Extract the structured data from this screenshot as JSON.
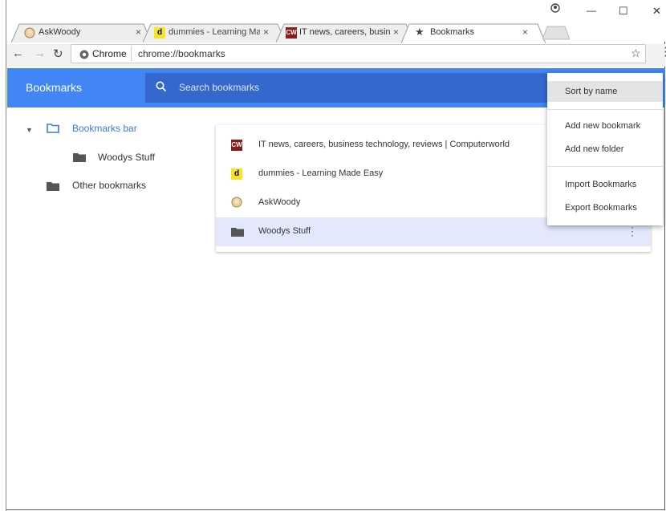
{
  "tabs": [
    {
      "title": "AskWoody",
      "close": "×"
    },
    {
      "title": "dummies - Learning Made Easy",
      "close": "×",
      "favicon_text": "d"
    },
    {
      "title": "IT news, careers, business technology, reviews | Computerworld",
      "close": "×",
      "favicon_text": "CW"
    },
    {
      "title": "Bookmarks",
      "close": "×"
    }
  ],
  "window_controls": {
    "minimize": "—",
    "maximize": "☐",
    "close": "✕"
  },
  "omnibox": {
    "site_label": "Chrome",
    "url": "chrome://bookmarks"
  },
  "bookmarks_page": {
    "title": "Bookmarks",
    "search_placeholder": "Search bookmarks",
    "nav": [
      {
        "label": "Bookmarks bar"
      },
      {
        "label": "Woodys Stuff"
      },
      {
        "label": "Other bookmarks"
      }
    ],
    "items": [
      {
        "label": "IT news, careers, business technology, reviews | Computerworld",
        "favicon_text": "CW"
      },
      {
        "label": "dummies - Learning Made Easy",
        "favicon_text": "d"
      },
      {
        "label": "AskWoody"
      },
      {
        "label": "Woodys Stuff"
      }
    ]
  },
  "menu": {
    "items": [
      "Sort by name",
      "Add new bookmark",
      "Add new folder",
      "Import Bookmarks",
      "Export Bookmarks"
    ]
  },
  "colors": {
    "header_blue": "#4285f4",
    "search_blue": "#3468cc",
    "selected_row": "#e3e9fb",
    "nav_active": "#3b78e7"
  }
}
